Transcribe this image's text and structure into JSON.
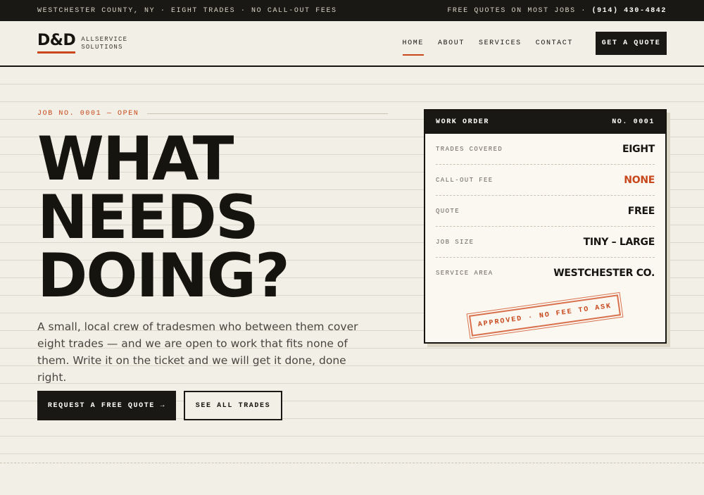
{
  "topbar": {
    "left": "WESTCHESTER COUNTY, NY · EIGHT TRADES · NO CALL-OUT FEES",
    "right_prefix": "FREE QUOTES ON MOST JOBS ·",
    "phone": "(914) 430-4842"
  },
  "header": {
    "logo_mark": "D&D",
    "logo_line1": "ALLSERVICE",
    "logo_line2": "SOLUTIONS",
    "nav": [
      {
        "label": "HOME",
        "active": true
      },
      {
        "label": "ABOUT",
        "active": false
      },
      {
        "label": "SERVICES",
        "active": false
      },
      {
        "label": "CONTACT",
        "active": false
      }
    ],
    "cta_label": "GET A QUOTE"
  },
  "hero": {
    "job_tag": "JOB NO. 0001 — OPEN",
    "headline": [
      "WHAT",
      "NEEDS",
      "DOING?"
    ],
    "lede": "A small, local crew of tradesmen who between them cover eight trades — and we are open to work that fits none of them. Write it on the ticket and we will get it done, done right.",
    "primary_button": "REQUEST A FREE QUOTE →",
    "secondary_button": "SEE ALL TRADES"
  },
  "work_order": {
    "title": "WORK ORDER",
    "number": "NO. 0001",
    "rows": [
      {
        "label": "TRADES COVERED",
        "value": "EIGHT"
      },
      {
        "label": "CALL-OUT FEE",
        "value": "NONE"
      },
      {
        "label": "QUOTE",
        "value": "FREE"
      },
      {
        "label": "JOB SIZE",
        "value": "TINY – LARGE"
      },
      {
        "label": "SERVICE AREA",
        "value": "WESTCHESTER CO."
      }
    ],
    "stamp": "APPROVED · NO FEE TO ASK"
  },
  "colors": {
    "accent": "#c8471b",
    "ink": "#16140f",
    "paper": "#f2efe6"
  }
}
